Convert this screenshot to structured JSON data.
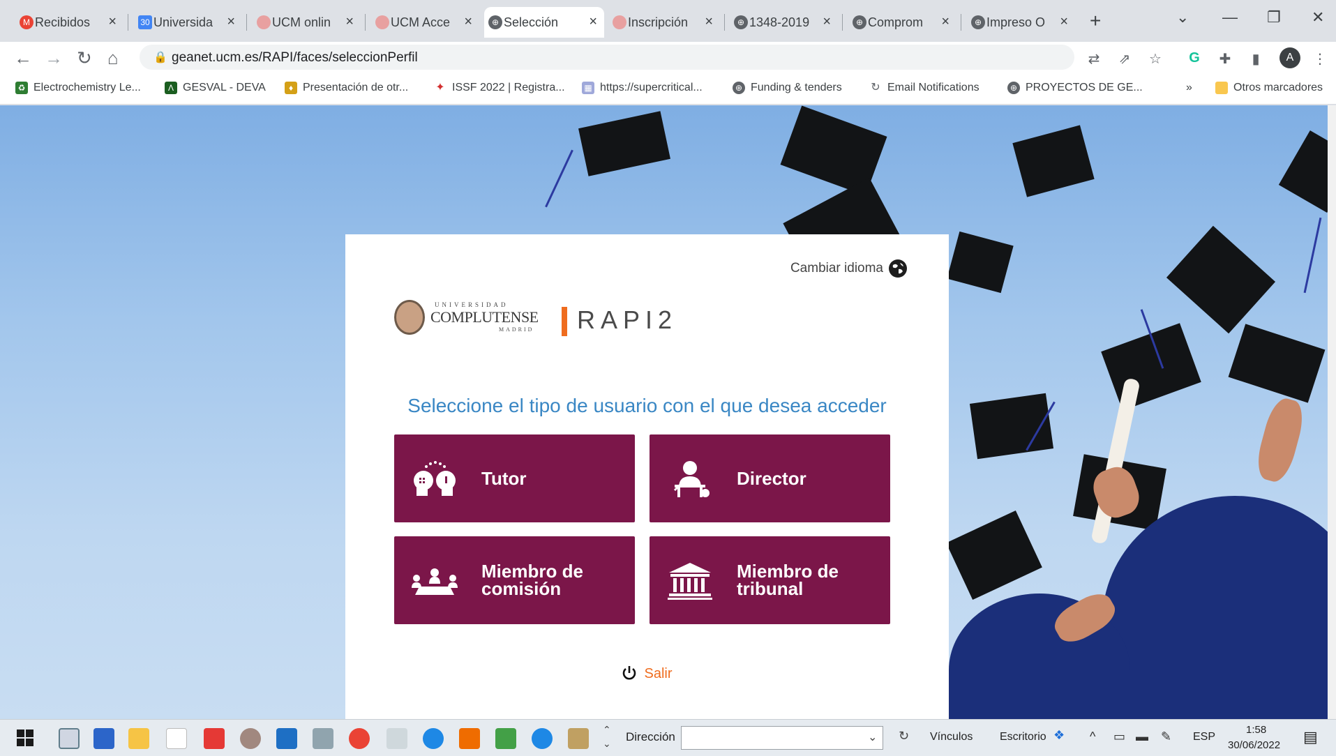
{
  "browser": {
    "tabs": [
      {
        "label": "Recibidos",
        "favicon": "gmail-icon"
      },
      {
        "label": "Universida",
        "favicon": "calendar-icon"
      },
      {
        "label": "UCM onlin",
        "favicon": "ucm-icon"
      },
      {
        "label": "UCM Acce",
        "favicon": "ucm-icon"
      },
      {
        "label": "Selección",
        "favicon": "globe-icon",
        "active": true
      },
      {
        "label": "Inscripción",
        "favicon": "ucm-icon"
      },
      {
        "label": "1348-2019",
        "favicon": "globe-icon"
      },
      {
        "label": "Comprom",
        "favicon": "globe-icon"
      },
      {
        "label": "Impreso O",
        "favicon": "globe-icon"
      }
    ],
    "url": "geanet.ucm.es/RAPI/faces/seleccionPerfil",
    "avatar_letter": "A",
    "bookmarks": [
      "Electrochemistry Le...",
      "GESVAL - DEVA",
      "Presentación de otr...",
      "ISSF 2022 | Registra...",
      "https://supercritical...",
      "Funding & tenders",
      "Email Notifications",
      "PROYECTOS DE GE..."
    ],
    "bookmarks_more": "»",
    "other_bookmarks": "Otros marcadores"
  },
  "page": {
    "change_language": "Cambiar idioma",
    "logo_top": "UNIVERSIDAD",
    "logo_name": "COMPLUTENSE",
    "logo_bottom": "MADRID",
    "app_name": "RAPI2",
    "prompt": "Seleccione el tipo de usuario con el que desea acceder",
    "roles": [
      {
        "label": "Tutor",
        "icon": "tutor-icon"
      },
      {
        "label": "Director",
        "icon": "director-icon"
      },
      {
        "label": "Miembro de comisión",
        "line1": "Miembro de",
        "line2": "comisión",
        "icon": "committee-icon"
      },
      {
        "label": "Miembro de tribunal",
        "line1": "Miembro de",
        "line2": "tribunal",
        "icon": "court-icon"
      }
    ],
    "logout": "Salir",
    "accent_color": "#7b1649",
    "orange": "#ef6c1e"
  },
  "taskbar": {
    "address_label": "Dirección",
    "links_label": "Vínculos",
    "desktop_label": "Escritorio",
    "language": "ESP",
    "time": "1:58",
    "date": "30/06/2022"
  }
}
